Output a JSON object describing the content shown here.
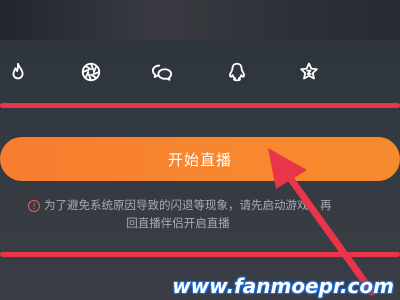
{
  "share": {
    "icons": [
      "flame-icon",
      "aperture-icon",
      "chat-bubbles-icon",
      "qq-penguin-icon",
      "star-badge-icon"
    ]
  },
  "live_button": {
    "label": "开始直播"
  },
  "notice": {
    "line1": "为了避免系统原因导致的闪退等现象，请先启动游戏，再",
    "line2": "回直播伴侣开启直播"
  },
  "watermark": {
    "text": "www.fanmoepr.com"
  },
  "colors": {
    "accent_orange": "#f8862f",
    "annotation_red": "#e8354a",
    "notice_text": "#a7acb4",
    "warning_red": "#e06060"
  }
}
